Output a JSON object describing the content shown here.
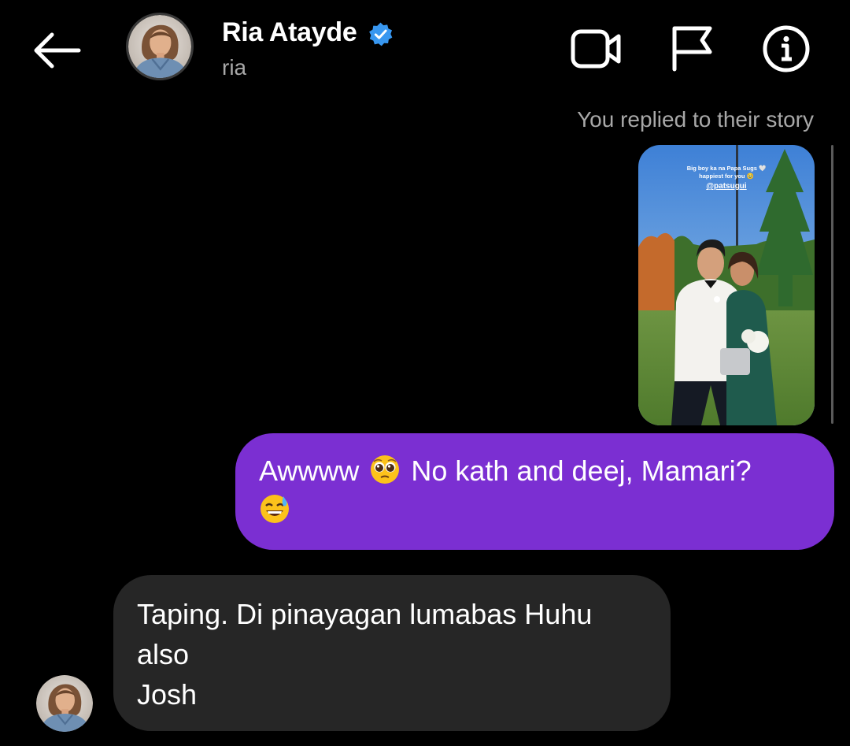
{
  "header": {
    "display_name": "Ria Atayde",
    "username": "ria",
    "icons": {
      "back": "arrow-left-icon",
      "verified": "verified-badge-icon",
      "video": "video-camera-icon",
      "report": "flag-icon",
      "info": "info-icon"
    },
    "verified_color": "#3897f0"
  },
  "thread": {
    "story_reply_note": "You replied to their story",
    "story_text": {
      "line1": "Big boy ka na Papa Sugs 🤍",
      "line2": "happiest for you 🥹",
      "mention": "@patsugui"
    },
    "sent_message": {
      "part1": "Awwww",
      "emoji1": "pleading-face-emoji",
      "part2": "No kath and deej, Mamari?",
      "emoji2": "grinning-face-with-sweat-emoji"
    },
    "received_message": {
      "line1": "Taping. Di pinayagan lumabas Huhu",
      "line2": "also",
      "line3": "Josh"
    }
  },
  "colors": {
    "background": "#000000",
    "sent_bubble": "#7b2fd2",
    "received_bubble": "#262626",
    "muted_text": "#a8a8a8"
  }
}
